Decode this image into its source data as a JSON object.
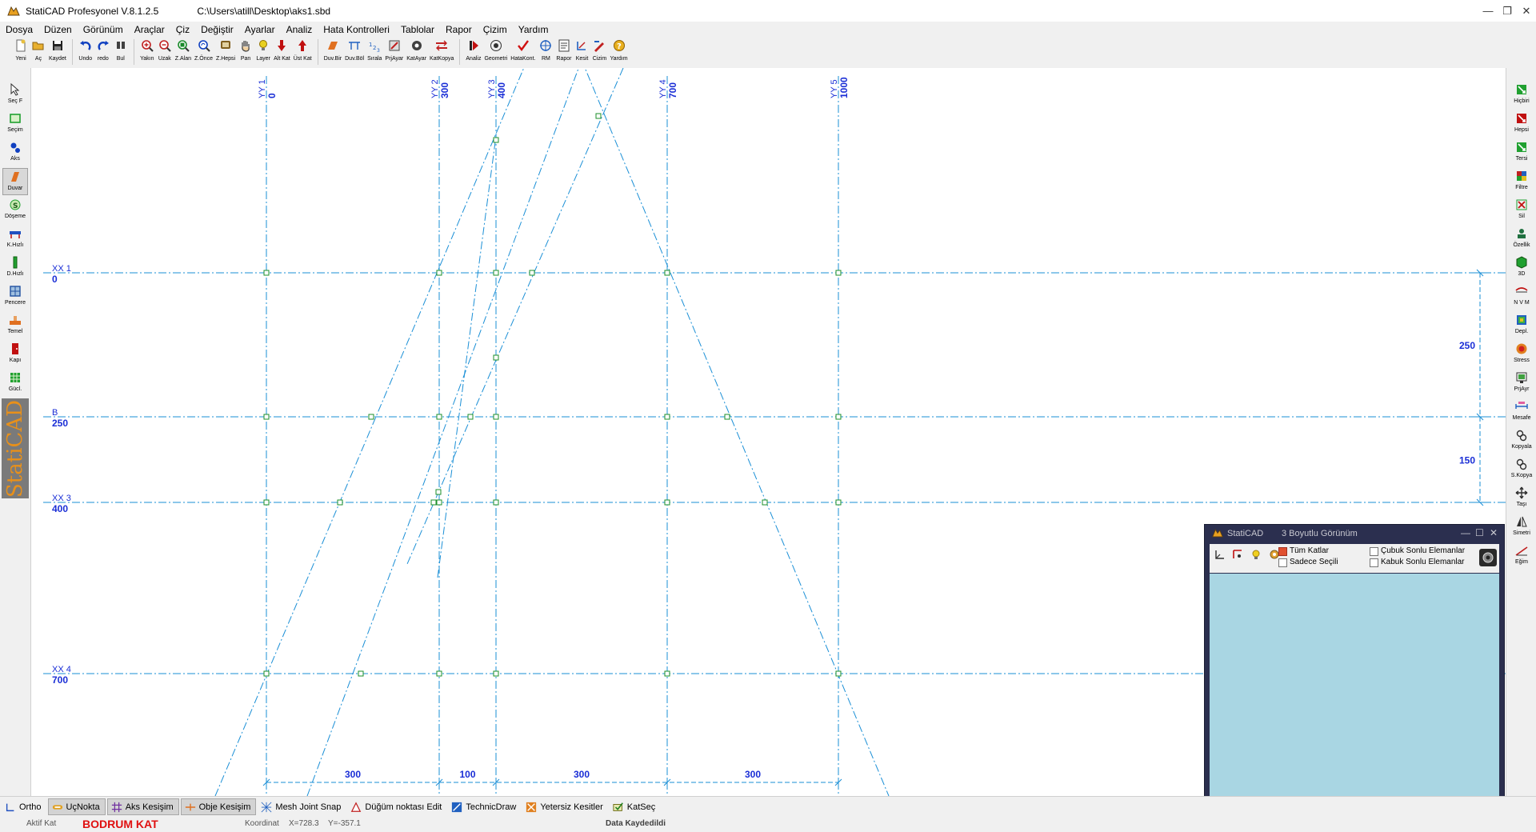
{
  "title": {
    "app_name": "StatiCAD Profesyonel V.8.1.2.5",
    "file_path": "C:\\Users\\atill\\Desktop\\aks1.sbd",
    "minimize": "—",
    "maximize": "❐",
    "close": "✕"
  },
  "menu": [
    "Dosya",
    "Düzen",
    "Görünüm",
    "Araçlar",
    "Çiz",
    "Değiştir",
    "Ayarlar",
    "Analiz",
    "Hata Kontrolleri",
    "Tablolar",
    "Rapor",
    "Çizim",
    "Yardım"
  ],
  "toolbar": [
    {
      "label": "Yeni",
      "icon": "new-file-icon",
      "color": "#e8c040"
    },
    {
      "label": "Aç",
      "icon": "open-folder-icon",
      "color": "#e8b030"
    },
    {
      "label": "Kaydet",
      "icon": "save-disk-icon",
      "color": "#222222"
    },
    {
      "sep": true
    },
    {
      "label": "Undo",
      "icon": "undo-arrow-icon",
      "color": "#1040c0"
    },
    {
      "label": "redo",
      "icon": "redo-arrow-icon",
      "color": "#1040c0"
    },
    {
      "label": "Bul",
      "icon": "find-icon",
      "color": "#404040"
    },
    {
      "sep": true
    },
    {
      "label": "Yakın",
      "icon": "zoom-in-icon",
      "color": "#c02020"
    },
    {
      "label": "Uzak",
      "icon": "zoom-out-icon",
      "color": "#c02020"
    },
    {
      "label": "Z.Alan",
      "icon": "zoom-area-icon",
      "color": "#1a8a2a"
    },
    {
      "label": "Z.Önce",
      "icon": "zoom-previous-icon",
      "color": "#1040c0"
    },
    {
      "label": "Z.Hepsi",
      "icon": "zoom-all-icon",
      "color": "#806020"
    },
    {
      "label": "Pan",
      "icon": "pan-hand-icon",
      "color": "#404040"
    },
    {
      "label": "Layer",
      "icon": "layer-bulb-icon",
      "color": "#e8d020"
    },
    {
      "label": "Alt Kat",
      "icon": "lower-floor-icon",
      "color": "#c01010"
    },
    {
      "label": "Üst Kat",
      "icon": "upper-floor-icon",
      "color": "#c01010"
    },
    {
      "sep": true
    },
    {
      "label": "Duv.Bir",
      "icon": "wall-join-icon",
      "color": "#e07020"
    },
    {
      "label": "Duv.Böl",
      "icon": "wall-split-icon",
      "color": "#2060c0"
    },
    {
      "label": "Sırala",
      "icon": "order-icon",
      "color": "#2060c0"
    },
    {
      "label": "PrjAyar",
      "icon": "project-settings-icon",
      "color": "#c02020"
    },
    {
      "label": "KatAyar",
      "icon": "floor-settings-icon",
      "color": "#404040"
    },
    {
      "label": "KatKopya",
      "icon": "floor-copy-icon",
      "color": "#c02020"
    },
    {
      "sep": true
    },
    {
      "label": "Analiz",
      "icon": "analysis-icon",
      "color": "#c01010"
    },
    {
      "label": "Geometri",
      "icon": "geometry-icon",
      "color": "#303030"
    },
    {
      "label": "HataKont.",
      "icon": "error-check-icon",
      "color": "#d01010"
    },
    {
      "label": "RM",
      "icon": "rm-target-icon",
      "color": "#2060c0"
    },
    {
      "label": "Rapor",
      "icon": "report-icon",
      "color": "#404040"
    },
    {
      "label": "Kesit",
      "icon": "section-icon",
      "color": "#2060c0"
    },
    {
      "label": "Cizim",
      "icon": "drawing-icon",
      "color": "#c02020"
    },
    {
      "label": "Yardım",
      "icon": "help-icon",
      "color": "#e8b020"
    }
  ],
  "left_tools": [
    {
      "label": "Seç F",
      "icon": "select-arrow-icon",
      "color": "#303030"
    },
    {
      "label": "Seçim",
      "icon": "selection-box-icon",
      "color": "#20a030"
    },
    {
      "label": "Aks",
      "icon": "axis-icon",
      "color": "#1040c0"
    },
    {
      "label": "Duvar",
      "icon": "wall-icon",
      "color": "#e07020",
      "active": true
    },
    {
      "label": "Döşeme",
      "icon": "slab-icon",
      "color": "#20a030"
    },
    {
      "label": "K.Hızlı",
      "icon": "beam-quick-icon",
      "color": "#2050c0"
    },
    {
      "label": "D.Hızlı",
      "icon": "column-quick-icon",
      "color": "#20a030"
    },
    {
      "label": "Pencere",
      "icon": "window-icon",
      "color": "#2050a0"
    },
    {
      "label": "Temel",
      "icon": "foundation-icon",
      "color": "#e07020"
    },
    {
      "label": "Kapı",
      "icon": "door-icon",
      "color": "#c01010"
    },
    {
      "label": "Gücl.",
      "icon": "strengthen-icon",
      "color": "#20a030"
    }
  ],
  "brand": "StatiCAD",
  "right_tools": [
    {
      "label": "Hiçbiri",
      "icon": "select-none-icon",
      "color": "#20a030"
    },
    {
      "label": "Hepsi",
      "icon": "select-all-icon",
      "color": "#c01010"
    },
    {
      "label": "Tersi",
      "icon": "select-inverse-icon",
      "color": "#20a030"
    },
    {
      "label": "Filtre",
      "icon": "filter-icon",
      "color": "#20a030"
    },
    {
      "label": "Sil",
      "icon": "delete-icon",
      "color": "#20a030"
    },
    {
      "label": "Özellik",
      "icon": "properties-icon",
      "color": "#207040"
    },
    {
      "label": "3D",
      "icon": "view-3d-icon",
      "color": "#20a030"
    },
    {
      "label": "N V M",
      "icon": "nvm-icon",
      "color": "#c01010"
    },
    {
      "label": "Depl.",
      "icon": "displacement-icon",
      "color": "#2060c0"
    },
    {
      "label": "Stress",
      "icon": "stress-icon",
      "color": "#d02020"
    },
    {
      "label": "PrjAyr",
      "icon": "project-adjust-icon",
      "color": "#303030"
    },
    {
      "label": "Mesafe",
      "icon": "distance-icon",
      "color": "#2060c0"
    },
    {
      "label": "Kopyala",
      "icon": "copy-icon",
      "color": "#303030"
    },
    {
      "label": "S.Kopya",
      "icon": "special-copy-icon",
      "color": "#303030"
    },
    {
      "label": "Taşı",
      "icon": "move-icon",
      "color": "#303030"
    },
    {
      "label": "Simetri",
      "icon": "mirror-icon",
      "color": "#303030"
    },
    {
      "label": "Eğim",
      "icon": "slope-icon",
      "color": "#c02020"
    }
  ],
  "drawing": {
    "line_color": "#1a8fd6",
    "label_color": "#1a2ed6",
    "node_color": "#1b8f2a",
    "vertical_axes": [
      {
        "name": "YY 1",
        "value": "0"
      },
      {
        "name": "YY 2",
        "value": "300"
      },
      {
        "name": "YY 3",
        "value": "400"
      },
      {
        "name": "YY 4",
        "value": "700"
      },
      {
        "name": "YY 5",
        "value": "1000"
      }
    ],
    "horizontal_axes": [
      {
        "name": "XX 1",
        "value": "0"
      },
      {
        "name": "B",
        "value": "250"
      },
      {
        "name": "XX 3",
        "value": "400"
      },
      {
        "name": "XX 4",
        "value": "700"
      }
    ],
    "bottom_dimensions": [
      "300",
      "100",
      "300",
      "300"
    ],
    "right_dimensions": [
      "250",
      "150"
    ]
  },
  "window3d": {
    "app": "StatiCAD",
    "title": "3 Boyutlu Görünüm",
    "minimize": "—",
    "maximize": "☐",
    "close": "✕",
    "tum_katlar": "Tüm Katlar",
    "sadece_secili": "Sadece Seçili",
    "cubuk": "Çubuk Sonlu Elemanlar",
    "kabuk": "Kabuk Sonlu Elemanlar",
    "background_color": "#a9d6e3"
  },
  "snaps": [
    {
      "label": "Ortho",
      "icon": "ortho-icon",
      "on": false
    },
    {
      "label": "UçNokta",
      "icon": "endpoint-icon",
      "on": true
    },
    {
      "label": "Aks Kesişim",
      "icon": "axis-intersection-icon",
      "on": true
    },
    {
      "label": "Obje Kesişim",
      "icon": "object-intersection-icon",
      "on": true
    },
    {
      "label": "Mesh Joint Snap",
      "icon": "mesh-joint-icon",
      "on": false
    },
    {
      "label": "Düğüm noktası Edit",
      "icon": "node-edit-icon",
      "on": false
    },
    {
      "label": "TechnicDraw",
      "icon": "technic-draw-icon",
      "on": false
    },
    {
      "label": "Yetersiz Kesitler",
      "icon": "insufficient-sections-icon",
      "on": false
    },
    {
      "label": "KatSeç",
      "icon": "floor-select-icon",
      "on": false
    }
  ],
  "status": {
    "aktif_kat_label": "Aktif Kat",
    "aktif_kat_value": "BODRUM KAT",
    "koordinat_label": "Koordinat",
    "x": "X=728.3",
    "y": "Y=-357.1",
    "saved": "Data Kaydedildi"
  }
}
